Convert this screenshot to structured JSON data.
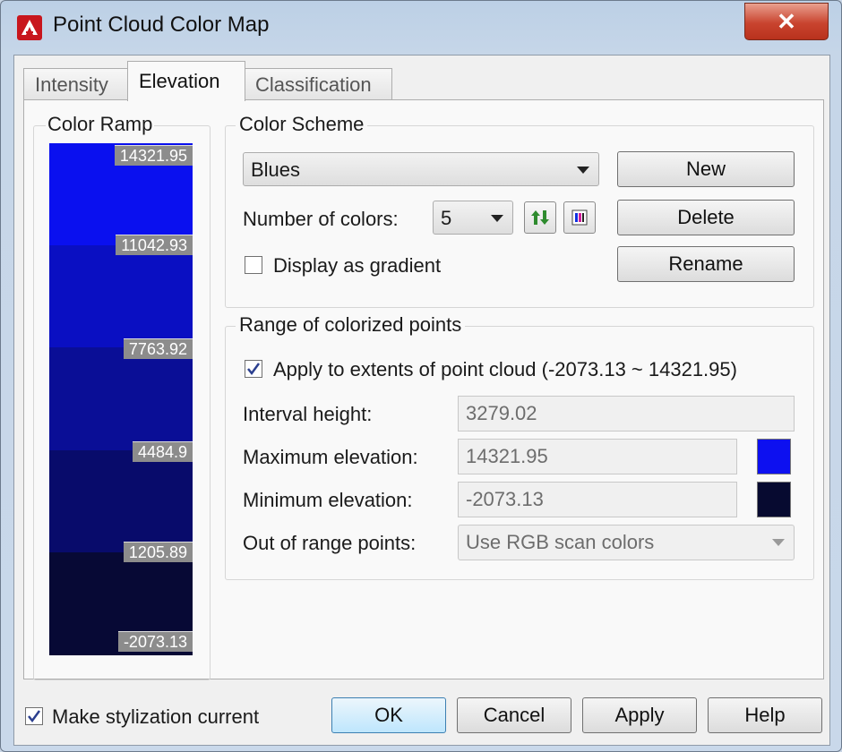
{
  "window": {
    "title": "Point Cloud Color Map",
    "close_glyph": "✕"
  },
  "tabs": [
    {
      "label": "Intensity",
      "active": false
    },
    {
      "label": "Elevation",
      "active": true
    },
    {
      "label": "Classification",
      "active": false
    }
  ],
  "color_ramp": {
    "title": "Color Ramp",
    "segments": [
      {
        "color": "#0a10ef",
        "label": "14321.95"
      },
      {
        "color": "#0a0fc2",
        "label": "11042.93"
      },
      {
        "color": "#0a0e96",
        "label": "7763.92"
      },
      {
        "color": "#080b6b",
        "label": "4484.9"
      },
      {
        "color": "#070935",
        "label": "1205.89"
      }
    ],
    "bottom_label": "-2073.13"
  },
  "color_scheme": {
    "title": "Color Scheme",
    "selected": "Blues",
    "number_of_colors_label": "Number of colors:",
    "number_of_colors": "5",
    "display_as_gradient_label": "Display as gradient",
    "display_as_gradient": false,
    "new_label": "New",
    "delete_label": "Delete",
    "rename_label": "Rename"
  },
  "range": {
    "title": "Range of colorized points",
    "apply_label": "Apply to extents of point cloud  (-2073.13 ~ 14321.95)",
    "apply_checked": true,
    "interval_label": "Interval height:",
    "interval_value": "3279.02",
    "max_label": "Maximum elevation:",
    "max_value": "14321.95",
    "max_color": "#0d10f0",
    "min_label": "Minimum elevation:",
    "min_value": "-2073.13",
    "min_color": "#070a30",
    "out_of_range_label": "Out of range points:",
    "out_of_range_value": "Use RGB scan colors"
  },
  "footer": {
    "make_current_label": "Make stylization current",
    "make_current_checked": true,
    "ok_label": "OK",
    "cancel_label": "Cancel",
    "apply_label": "Apply",
    "help_label": "Help"
  }
}
